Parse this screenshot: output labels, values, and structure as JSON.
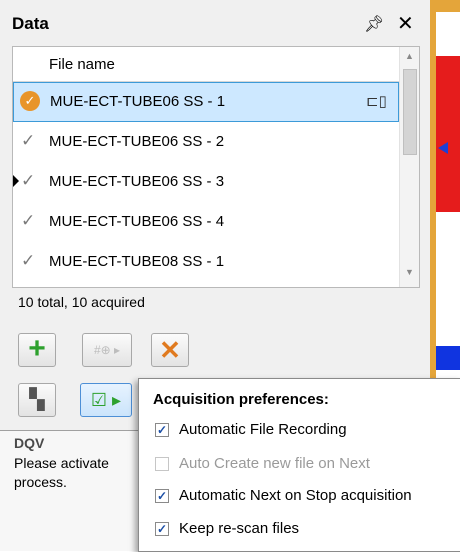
{
  "panel": {
    "title": "Data",
    "pin_icon": "pin-icon",
    "close_glyph": "✕"
  },
  "list": {
    "header": "File name",
    "rows": [
      {
        "name": "MUE-ECT-TUBE06 SS - 1",
        "status": "current"
      },
      {
        "name": "MUE-ECT-TUBE06 SS - 2",
        "status": "acquired"
      },
      {
        "name": "MUE-ECT-TUBE06 SS - 3",
        "status": "acquired"
      },
      {
        "name": "MUE-ECT-TUBE06 SS - 4",
        "status": "acquired"
      },
      {
        "name": "MUE-ECT-TUBE08 SS - 1",
        "status": "acquired"
      }
    ]
  },
  "summary": "10 total, 10 acquired",
  "dqv": {
    "title": "DQV",
    "text": "Please activate process."
  },
  "popup": {
    "title": "Acquisition preferences:",
    "options": [
      {
        "label": "Automatic File Recording",
        "checked": true,
        "enabled": true
      },
      {
        "label": "Auto Create new file on Next",
        "checked": false,
        "enabled": false
      },
      {
        "label": "Automatic Next on Stop acquisition",
        "checked": true,
        "enabled": true
      },
      {
        "label": "Keep re-scan files",
        "checked": true,
        "enabled": true
      }
    ]
  },
  "colors": {
    "accent_orange": "#e8952b",
    "selection": "#cde8ff",
    "red_band": "#e51c1c",
    "blue_band": "#1034e0"
  }
}
